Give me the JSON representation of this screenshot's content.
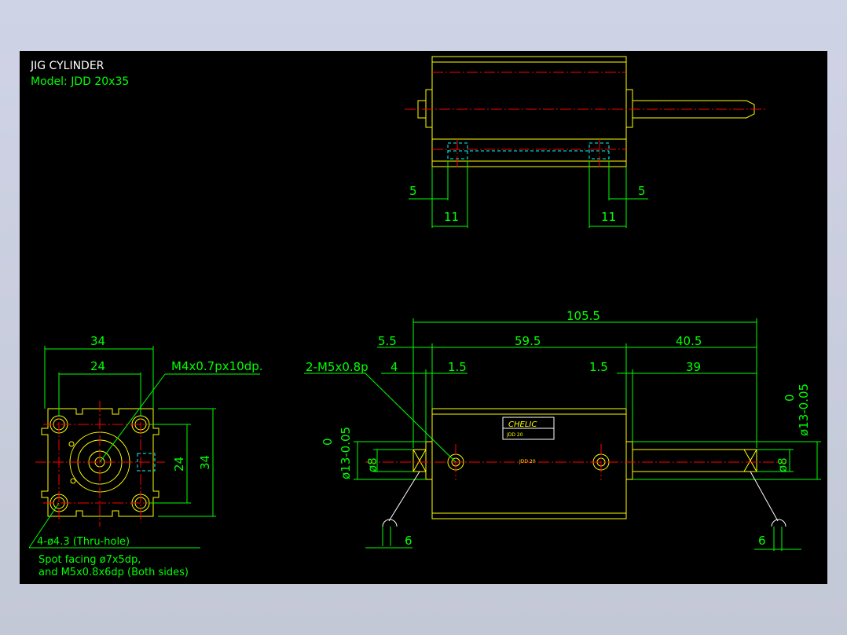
{
  "title": {
    "name": "JIG CYLINDER",
    "model": "Model:  JDD 20x35"
  },
  "top_view": {
    "dim_left_5": "5",
    "dim_right_5": "5",
    "dim_left_11": "11",
    "dim_right_11": "11"
  },
  "side_view": {
    "dim_34_width": "34",
    "dim_24_width": "24",
    "dim_24_height": "24",
    "dim_34_height": "34",
    "thread_callout": "M4x0.7px10dp.",
    "hole_callout": "4-ø4.3 (Thru-hole)",
    "spot_note_1": "Spot facing ø7x5dp,",
    "spot_note_2": "and M5x0.8x6dp (Both sides)"
  },
  "front_view": {
    "dim_total": "105.5",
    "dim_5_5": "5.5",
    "dim_59_5": "59.5",
    "dim_40_5": "40.5",
    "dim_4": "4",
    "dim_1_5_left": "1.5",
    "dim_1_5_right": "1.5",
    "dim_39": "39",
    "port_callout": "2-M5x0.8p",
    "shaft_tol_left": "ø13-0.05",
    "shaft_tol_left_zero": "0",
    "shaft_dia_left": "ø8",
    "shaft_tol_right": "ø13-0.05",
    "shaft_tol_right_zero": "0",
    "shaft_dia_right": "ø8",
    "dim_6_left": "6",
    "dim_6_right": "6",
    "brand": "CHELIC",
    "label_text": "JDD 20",
    "body_text": "JDD 20"
  }
}
